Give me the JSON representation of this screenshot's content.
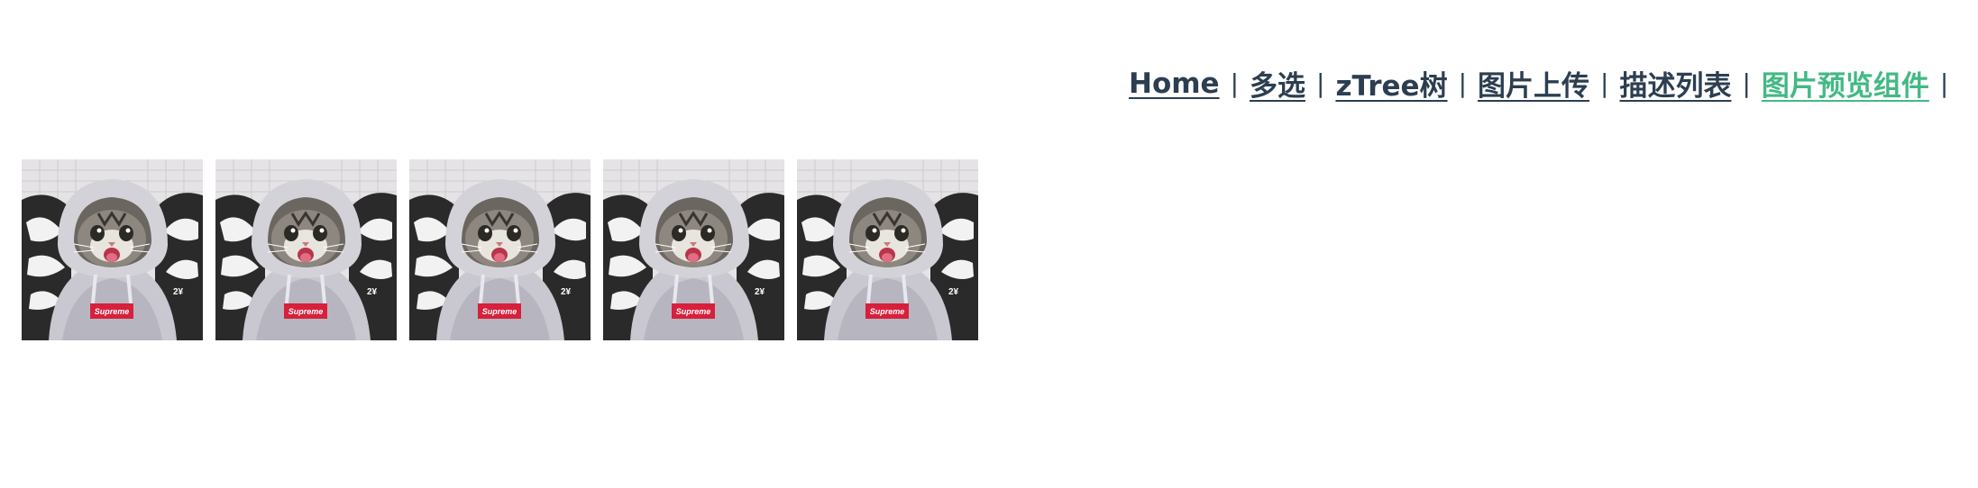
{
  "nav": {
    "items": [
      {
        "label": "Home",
        "active": false
      },
      {
        "label": "多选",
        "active": false
      },
      {
        "label": "zTree树",
        "active": false
      },
      {
        "label": "图片上传",
        "active": false
      },
      {
        "label": "描述列表",
        "active": false
      },
      {
        "label": "图片预览组件",
        "active": true
      }
    ],
    "separator": "|",
    "active_color": "#42b983",
    "link_color": "#2c3e50"
  },
  "gallery": {
    "image_icon": "cat-in-hoodie-photo",
    "count": 5
  }
}
